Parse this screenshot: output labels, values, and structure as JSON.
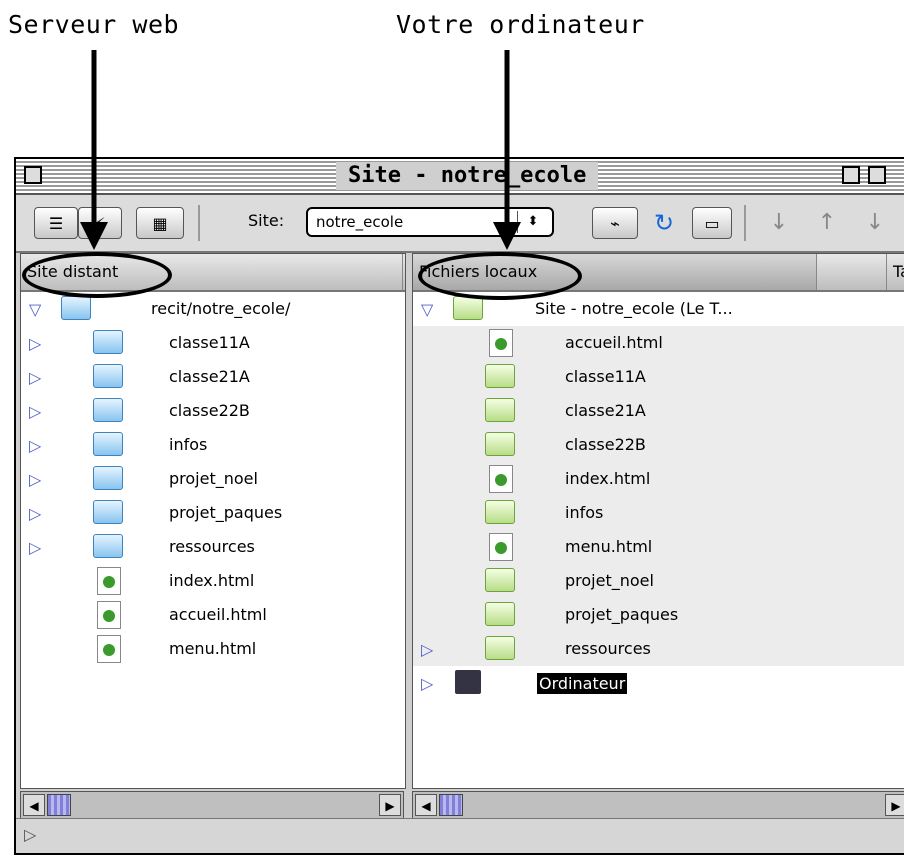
{
  "annotations": {
    "left_label": "Serveur web",
    "right_label": "Votre ordinateur"
  },
  "window": {
    "title": "Site - notre_ecole"
  },
  "toolbar": {
    "site_label": "Site:",
    "site_value": "notre_ecole"
  },
  "remote": {
    "column": "Site distant",
    "root": "recit/notre_ecole/",
    "items": [
      {
        "type": "folder",
        "name": "classe11A"
      },
      {
        "type": "folder",
        "name": "classe21A"
      },
      {
        "type": "folder",
        "name": "classe22B"
      },
      {
        "type": "folder",
        "name": "infos"
      },
      {
        "type": "folder",
        "name": "projet_noel"
      },
      {
        "type": "folder",
        "name": "projet_paques"
      },
      {
        "type": "folder",
        "name": "ressources"
      },
      {
        "type": "file",
        "name": "index.html"
      },
      {
        "type": "file",
        "name": "accueil.html"
      },
      {
        "type": "file",
        "name": "menu.html"
      }
    ]
  },
  "local": {
    "columns": [
      "Fichiers locaux",
      "",
      "Tai"
    ],
    "root": "Site - notre_ecole (Le T...",
    "items": [
      {
        "type": "file",
        "name": "accueil.html"
      },
      {
        "type": "folder",
        "name": "classe11A"
      },
      {
        "type": "folder",
        "name": "classe21A"
      },
      {
        "type": "folder",
        "name": "classe22B"
      },
      {
        "type": "file",
        "name": "index.html"
      },
      {
        "type": "folder",
        "name": "infos"
      },
      {
        "type": "file",
        "name": "menu.html"
      },
      {
        "type": "folder",
        "name": "projet_noel"
      },
      {
        "type": "folder",
        "name": "projet_paques"
      },
      {
        "type": "folder",
        "name": "ressources"
      }
    ],
    "computer": "Ordinateur"
  }
}
